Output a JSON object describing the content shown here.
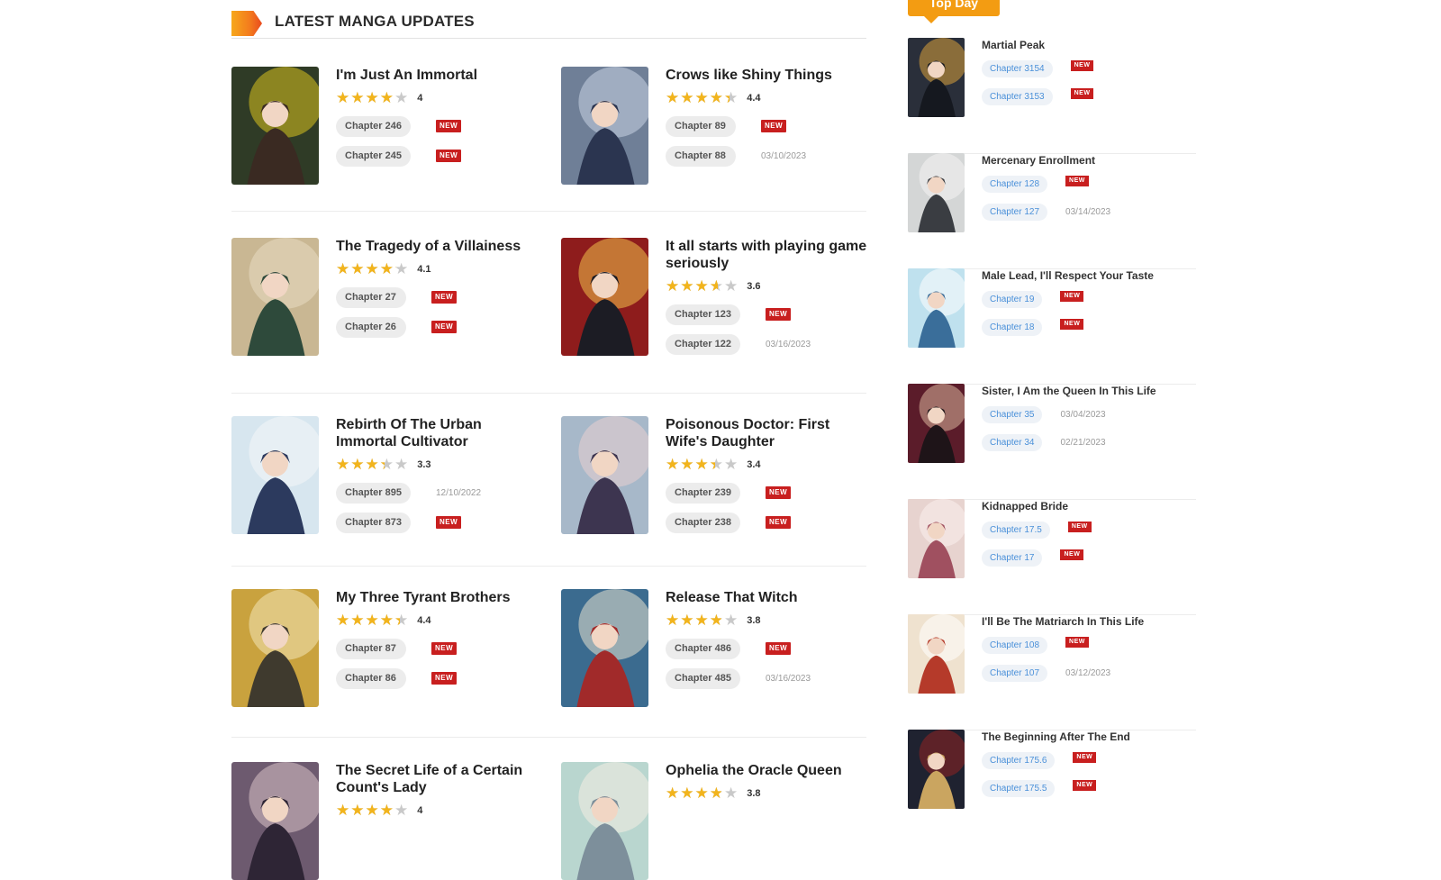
{
  "section": {
    "title": "LATEST MANGA UPDATES"
  },
  "manga_rows": [
    [
      {
        "title": "I'm Just An Immortal",
        "rating": 4,
        "rating_label": "4",
        "chapters": [
          {
            "label": "Chapter 246",
            "new": true,
            "date": ""
          },
          {
            "label": "Chapter 245",
            "new": true,
            "date": ""
          }
        ],
        "cover": {
          "bg": "#2f3b26",
          "accent": "#d8c21d",
          "figure": "#3a2a22"
        }
      },
      {
        "title": "Crows like Shiny Things",
        "rating": 4.4,
        "rating_label": "4.4",
        "chapters": [
          {
            "label": "Chapter 89",
            "new": true,
            "date": ""
          },
          {
            "label": "Chapter 88",
            "new": false,
            "date": "03/10/2023"
          }
        ],
        "cover": {
          "bg": "#6f7f97",
          "accent": "#c9d3e3",
          "figure": "#2b3550"
        }
      }
    ],
    [
      {
        "title": "The Tragedy of a Villainess",
        "rating": 4.1,
        "rating_label": "4.1",
        "chapters": [
          {
            "label": "Chapter 27",
            "new": true,
            "date": ""
          },
          {
            "label": "Chapter 26",
            "new": true,
            "date": ""
          }
        ],
        "cover": {
          "bg": "#c9b793",
          "accent": "#e8dcc3",
          "figure": "#2e4a3b"
        }
      },
      {
        "title": "It all starts with playing game seriously",
        "rating": 3.6,
        "rating_label": "3.6",
        "chapters": [
          {
            "label": "Chapter 123",
            "new": true,
            "date": ""
          },
          {
            "label": "Chapter 122",
            "new": false,
            "date": "03/16/2023"
          }
        ],
        "cover": {
          "bg": "#8e1c1c",
          "accent": "#f0c14a",
          "figure": "#1c1c24"
        }
      }
    ],
    [
      {
        "title": "Rebirth Of The Urban Immortal Cultivator",
        "rating": 3.3,
        "rating_label": "3.3",
        "chapters": [
          {
            "label": "Chapter 895",
            "new": false,
            "date": "12/10/2022"
          },
          {
            "label": "Chapter 873",
            "new": true,
            "date": ""
          }
        ],
        "cover": {
          "bg": "#d7e6ef",
          "accent": "#f4f6f8",
          "figure": "#2c3a5e"
        }
      },
      {
        "title": "Poisonous Doctor: First Wife's Daughter",
        "rating": 3.4,
        "rating_label": "3.4",
        "chapters": [
          {
            "label": "Chapter 239",
            "new": true,
            "date": ""
          },
          {
            "label": "Chapter 238",
            "new": true,
            "date": ""
          }
        ],
        "cover": {
          "bg": "#a7b8c9",
          "accent": "#e9d0cf",
          "figure": "#3d3550"
        }
      }
    ],
    [
      {
        "title": "My Three Tyrant Brothers",
        "rating": 4.4,
        "rating_label": "4.4",
        "chapters": [
          {
            "label": "Chapter 87",
            "new": true,
            "date": ""
          },
          {
            "label": "Chapter 86",
            "new": true,
            "date": ""
          }
        ],
        "cover": {
          "bg": "#c9a23e",
          "accent": "#f3e6b7",
          "figure": "#3f3a2e"
        }
      },
      {
        "title": "Release That Witch",
        "rating": 3.8,
        "rating_label": "3.8",
        "chapters": [
          {
            "label": "Chapter 486",
            "new": true,
            "date": ""
          },
          {
            "label": "Chapter 485",
            "new": false,
            "date": "03/16/2023"
          }
        ],
        "cover": {
          "bg": "#3b6b8f",
          "accent": "#e8e2d0",
          "figure": "#a12a2a"
        }
      }
    ],
    [
      {
        "title": "The Secret Life of a Certain Count's Lady",
        "rating": 4,
        "rating_label": "4",
        "chapters": [],
        "cover": {
          "bg": "#6d5a6f",
          "accent": "#d9c3c7",
          "figure": "#2e2535"
        }
      },
      {
        "title": "Ophelia the Oracle Queen",
        "rating": 3.8,
        "rating_label": "3.8",
        "chapters": [],
        "cover": {
          "bg": "#b9d6cf",
          "accent": "#f5efe3",
          "figure": "#7d8f9b"
        }
      }
    ]
  ],
  "sidebar": {
    "tab_label": "Top Day",
    "items": [
      {
        "title": "Martial Peak",
        "chapters": [
          {
            "label": "Chapter 3154",
            "new": true,
            "date": ""
          },
          {
            "label": "Chapter 3153",
            "new": true,
            "date": ""
          }
        ],
        "cover": {
          "bg": "#2a2f3a",
          "accent": "#d9a03a",
          "figure": "#15181f"
        }
      },
      {
        "title": "Mercenary Enrollment",
        "chapters": [
          {
            "label": "Chapter 128",
            "new": true,
            "date": ""
          },
          {
            "label": "Chapter 127",
            "new": false,
            "date": "03/14/2023"
          }
        ],
        "cover": {
          "bg": "#d4d6d6",
          "accent": "#f4f4f4",
          "figure": "#3a3d42"
        }
      },
      {
        "title": "Male Lead, I'll Respect Your Taste",
        "chapters": [
          {
            "label": "Chapter 19",
            "new": true,
            "date": ""
          },
          {
            "label": "Chapter 18",
            "new": true,
            "date": ""
          }
        ],
        "cover": {
          "bg": "#bfe1ee",
          "accent": "#ffffff",
          "figure": "#3a6e9a"
        }
      },
      {
        "title": "Sister, I Am the Queen In This Life",
        "chapters": [
          {
            "label": "Chapter 35",
            "new": false,
            "date": "03/04/2023"
          },
          {
            "label": "Chapter 34",
            "new": false,
            "date": "02/21/2023"
          }
        ],
        "cover": {
          "bg": "#5b1c2a",
          "accent": "#d8b59a",
          "figure": "#1e1418"
        }
      },
      {
        "title": "Kidnapped Bride",
        "chapters": [
          {
            "label": "Chapter 17.5",
            "new": true,
            "date": ""
          },
          {
            "label": "Chapter 17",
            "new": true,
            "date": ""
          }
        ],
        "cover": {
          "bg": "#e7d3cf",
          "accent": "#fbf1ee",
          "figure": "#a05060"
        }
      },
      {
        "title": "I'll Be The Matriarch In This Life",
        "chapters": [
          {
            "label": "Chapter 108",
            "new": true,
            "date": ""
          },
          {
            "label": "Chapter 107",
            "new": false,
            "date": "03/12/2023"
          }
        ],
        "cover": {
          "bg": "#efe2cf",
          "accent": "#ffffff",
          "figure": "#b53a2a"
        }
      },
      {
        "title": "The Beginning After The End",
        "chapters": [
          {
            "label": "Chapter 175.6",
            "new": true,
            "date": ""
          },
          {
            "label": "Chapter 175.5",
            "new": true,
            "date": ""
          }
        ],
        "cover": {
          "bg": "#1f2230",
          "accent": "#8f2222",
          "figure": "#caa560"
        }
      }
    ]
  },
  "labels": {
    "new_badge": "NEW",
    "star_glyphs": "★★★★★"
  },
  "colors": {
    "accent_orange": "#f39c12",
    "new_badge": "#c81f1f",
    "star": "#f2b41c",
    "sidebar_link": "#4a90d9"
  }
}
